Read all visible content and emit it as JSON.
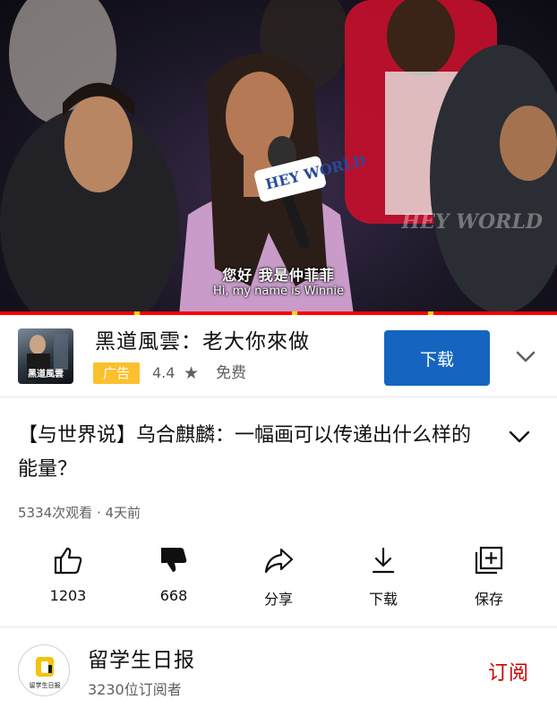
{
  "video": {
    "subtitle_zh": "您好 我是仲菲菲",
    "subtitle_en": "Hi, my name is Winnie",
    "mic_logo": "HEY WORLD",
    "watermark": "HEY WORLD",
    "progress_fraction": 1.0
  },
  "ad": {
    "title": "黑道風雲：老大你來做",
    "badge": "广告",
    "rating": "4.4",
    "star_icon": "star-icon",
    "price": "免费",
    "download_label": "下载",
    "thumb_text": "黑道風雲",
    "expand_icon": "chevron-down-icon"
  },
  "video_info": {
    "title": "【与世界说】乌合麒麟：一幅画可以传递出什么样的能量？",
    "meta": "5334次观看 · 4天前",
    "expand_icon": "chevron-down-icon"
  },
  "actions": [
    {
      "icon": "thumbs-up-icon",
      "label": "1203"
    },
    {
      "icon": "thumbs-down-icon",
      "label": "668"
    },
    {
      "icon": "share-icon",
      "label": "分享"
    },
    {
      "icon": "download-icon",
      "label": "下载"
    },
    {
      "icon": "save-to-playlist-icon",
      "label": "保存"
    }
  ],
  "channel": {
    "name": "留学生日报",
    "subscribers": "3230位订阅者",
    "avatar_caption": "留学生日报",
    "subscribe_label": "订阅"
  },
  "colors": {
    "accent_red": "#ff0000",
    "ad_blue": "#1565c0",
    "ad_badge": "#fbc02d",
    "subscribe": "#cc0000",
    "secondary_text": "#606060"
  }
}
